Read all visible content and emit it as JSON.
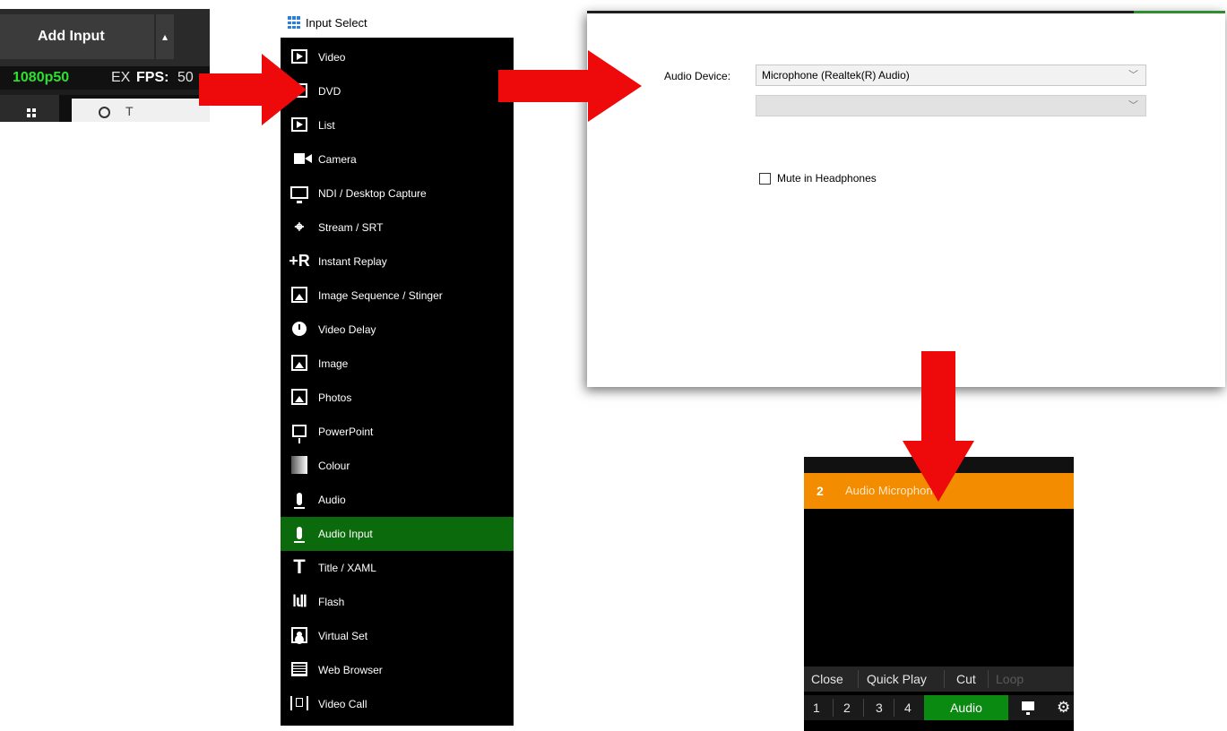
{
  "toolbar": {
    "add_input_label": "Add Input",
    "dropdown_glyph": "▴",
    "resolution": "1080p50",
    "ex_label": "EX",
    "fps_label": "FPS:",
    "fps_value": "50",
    "search_text": "T"
  },
  "input_select": {
    "title": "Input Select",
    "items": [
      {
        "label": "Video",
        "icon": "video-icon"
      },
      {
        "label": "DVD",
        "icon": "dvd-icon"
      },
      {
        "label": "List",
        "icon": "list-icon"
      },
      {
        "label": "Camera",
        "icon": "camera-icon"
      },
      {
        "label": "NDI / Desktop Capture",
        "icon": "monitor-icon"
      },
      {
        "label": "Stream / SRT",
        "icon": "antenna-icon"
      },
      {
        "label": "Instant Replay",
        "icon": "replay-icon"
      },
      {
        "label": "Image Sequence / Stinger",
        "icon": "image-sequence-icon"
      },
      {
        "label": "Video Delay",
        "icon": "clock-icon"
      },
      {
        "label": "Image",
        "icon": "image-icon"
      },
      {
        "label": "Photos",
        "icon": "photos-icon"
      },
      {
        "label": "PowerPoint",
        "icon": "powerpoint-icon"
      },
      {
        "label": "Colour",
        "icon": "colour-icon"
      },
      {
        "label": "Audio",
        "icon": "microphone-icon"
      },
      {
        "label": "Audio Input",
        "icon": "microphone-icon",
        "selected": true
      },
      {
        "label": "Title / XAML",
        "icon": "title-icon"
      },
      {
        "label": "Flash",
        "icon": "flash-icon"
      },
      {
        "label": "Virtual Set",
        "icon": "virtual-set-icon"
      },
      {
        "label": "Web Browser",
        "icon": "web-browser-icon"
      },
      {
        "label": "Video Call",
        "icon": "video-call-icon"
      }
    ]
  },
  "audio_dialog": {
    "device_label": "Audio Device:",
    "device_value": "Microphone (Realtek(R) Audio)",
    "secondary_value": "",
    "mute_label": "Mute in Headphones",
    "mute_checked": false
  },
  "input_tile": {
    "number": "2",
    "name": "Audio Microphone",
    "controls": [
      "Close",
      "Quick Play",
      "Cut",
      "Loop"
    ],
    "numbers": [
      "1",
      "2",
      "3",
      "4"
    ],
    "audio_button": "Audio",
    "header_color": "#f48c00",
    "audio_color": "#0b8a12"
  },
  "colors": {
    "arrow": "#ee0a0a",
    "selected": "#0b6a0b",
    "resolution_green": "#2ee02e"
  }
}
